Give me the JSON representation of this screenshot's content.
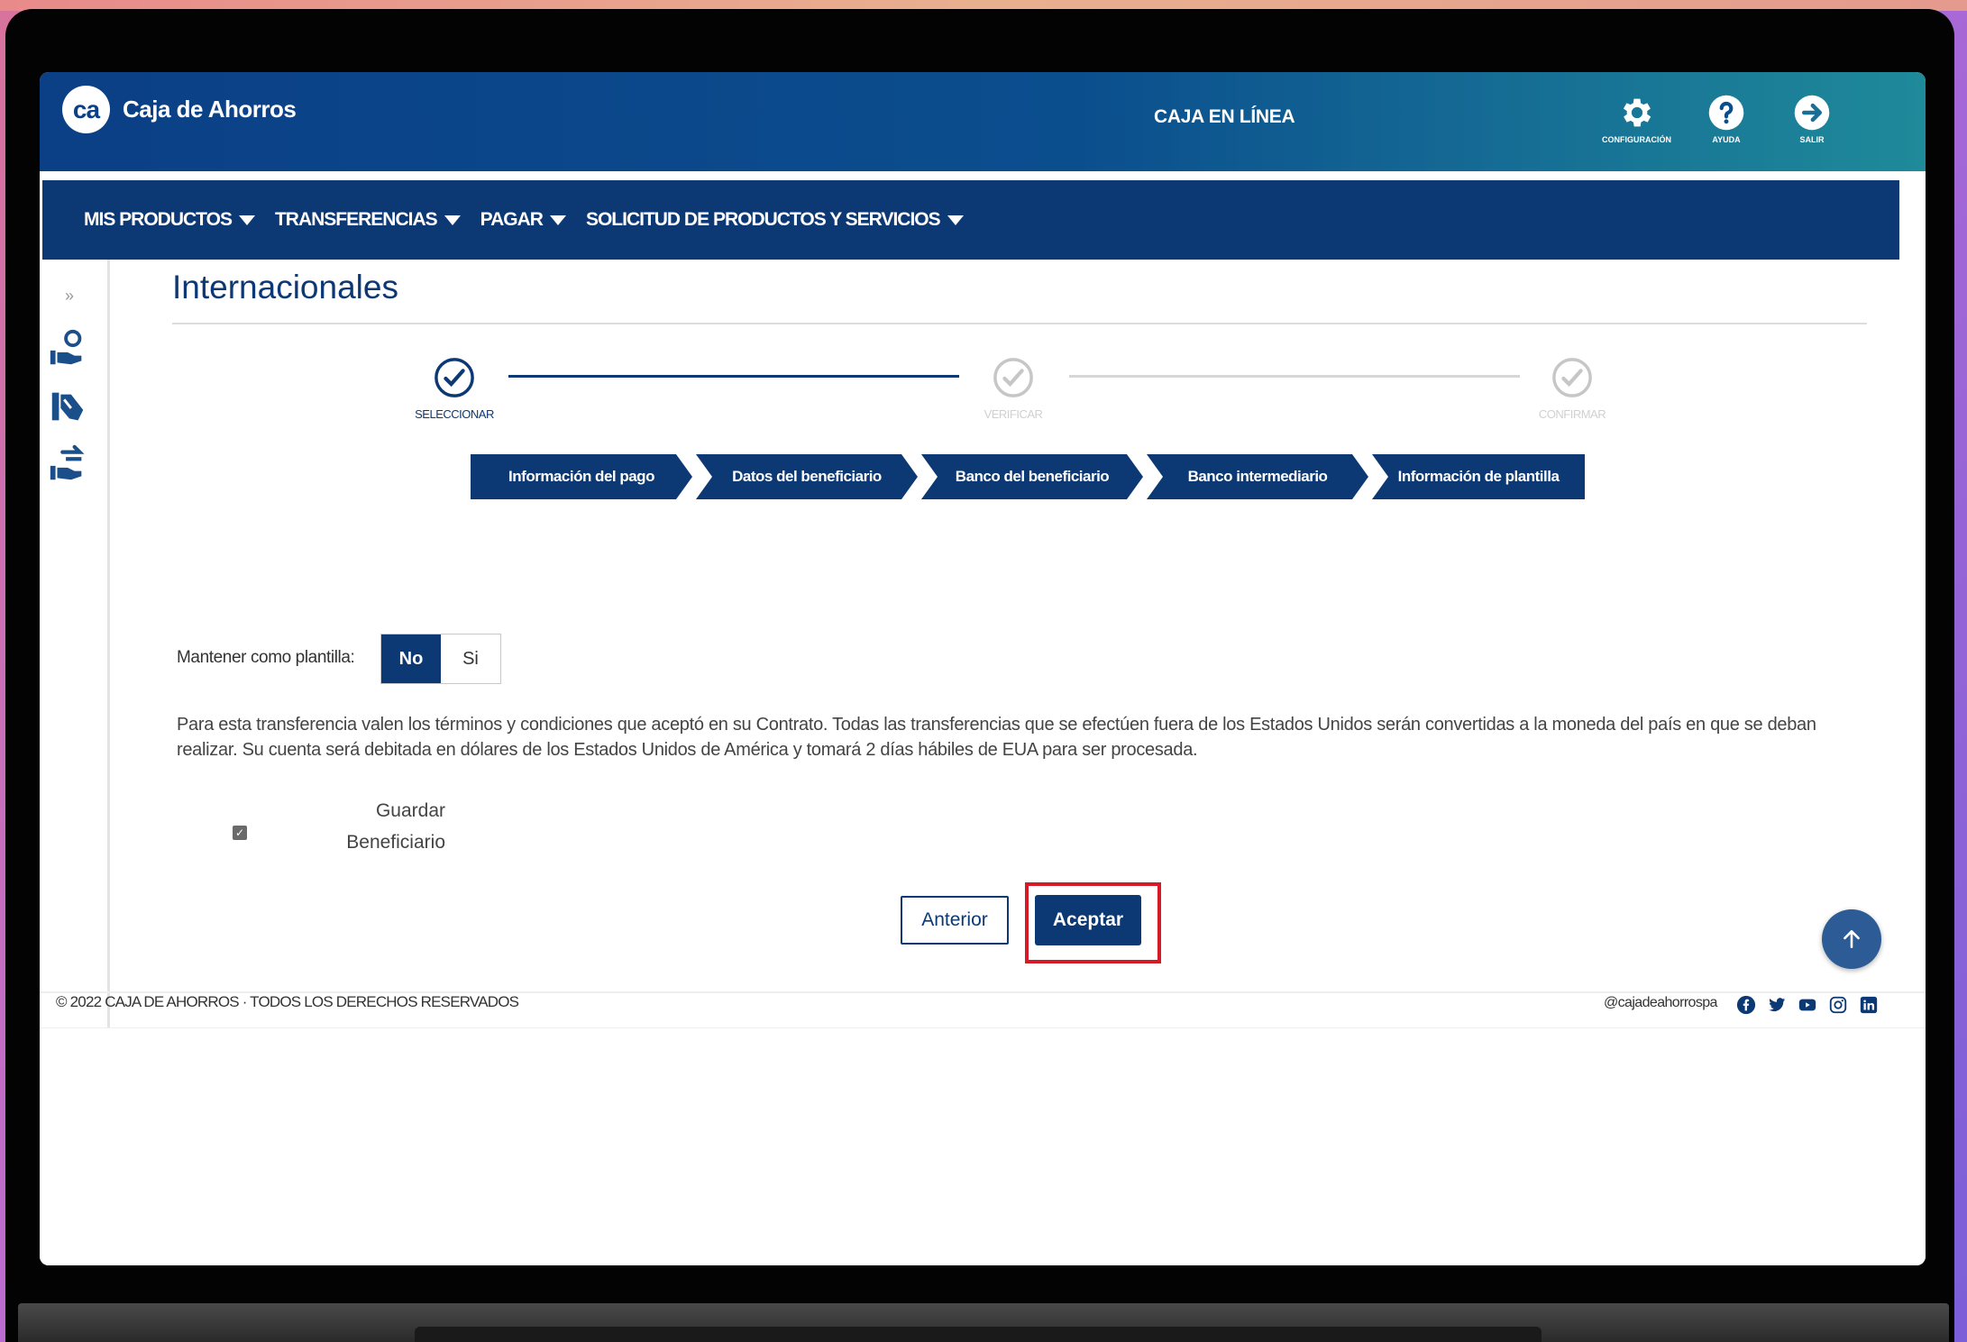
{
  "header": {
    "logo_text": "ca",
    "brand": "Caja de Ahorros",
    "title": "CAJA EN LÍNEA",
    "buttons": [
      {
        "label": "CONFIGURACIÓN",
        "icon": "gear-icon"
      },
      {
        "label": "AYUDA",
        "icon": "help-icon"
      },
      {
        "label": "SALIR",
        "icon": "logout-icon"
      }
    ]
  },
  "nav": {
    "items": [
      "MIS PRODUCTOS",
      "TRANSFERENCIAS",
      "PAGAR",
      "SOLICITUD DE PRODUCTOS Y SERVICIOS"
    ]
  },
  "sidebar": {
    "expand": "»",
    "icons": [
      "hand-coin-icon",
      "hand-cards-icon",
      "hand-transfer-icon"
    ]
  },
  "page": {
    "title": "Internacionales"
  },
  "stepper": {
    "steps": [
      {
        "label": "SELECCIONAR",
        "active": true
      },
      {
        "label": "VERIFICAR",
        "active": false
      },
      {
        "label": "CONFIRMAR",
        "active": false
      }
    ]
  },
  "tabs": [
    "Información del pago",
    "Datos del beneficiario",
    "Banco del beneficiario",
    "Banco intermediario",
    "Información de plantilla"
  ],
  "template": {
    "label": "Mantener como plantilla:",
    "options": [
      "No",
      "Si"
    ],
    "selected": "No"
  },
  "terms": "Para esta transferencia valen los términos y condiciones que aceptó en su Contrato. Todas las transferencias que se efectúen fuera de los Estados Unidos serán convertidas a la moneda del país en que se deban realizar. Su cuenta será debitada en dólares de los Estados Unidos de América y tomará 2 días hábiles de EUA para ser procesada.",
  "save_beneficiary": {
    "line1": "Guardar",
    "line2": "Beneficiario",
    "checked": true,
    "check_glyph": "✓"
  },
  "actions": {
    "previous": "Anterior",
    "accept": "Aceptar"
  },
  "footer": {
    "copyright": "© 2022 CAJA DE AHORROS · TODOS LOS DERECHOS RESERVADOS",
    "handle": "@cajadeahorrospa",
    "social_icons": [
      "facebook-icon",
      "twitter-icon",
      "youtube-icon",
      "instagram-icon",
      "linkedin-icon"
    ]
  },
  "colors": {
    "primary": "#0c3974",
    "teal": "#1f8a9a",
    "highlight": "#d51a28"
  }
}
